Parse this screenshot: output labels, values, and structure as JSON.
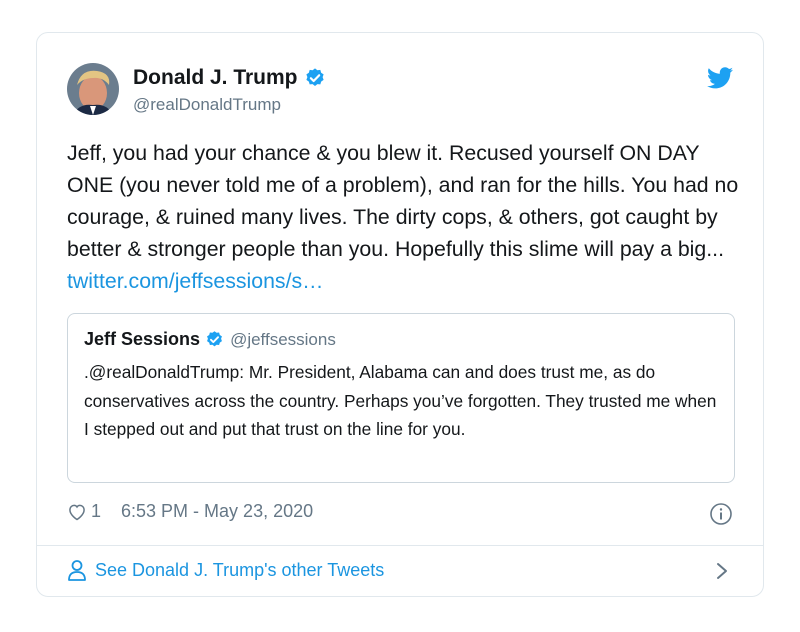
{
  "tweet": {
    "author": {
      "name": "Donald J. Trump",
      "handle": "@realDonaldTrump",
      "verified": true
    },
    "text_main": "Jeff, you had your chance & you blew it. Recused yourself ON DAY ONE (you never told me of a problem), and ran for the hills. You had no courage, & ruined many lives. The dirty cops, & others, got caught by better & stronger people than you. Hopefully this slime will pay a big... ",
    "link_text": "twitter.com/jeffsessions/s…",
    "quoted": {
      "author": {
        "name": "Jeff Sessions",
        "handle": "@jeffsessions",
        "verified": true
      },
      "text": ".@realDonaldTrump: Mr. President, Alabama can and does trust me, as do conservatives across the country. Perhaps you’ve forgotten. They trusted me when I stepped out and put that trust on the line for you."
    },
    "likes": "1",
    "timestamp": "6:53 PM - May 23, 2020"
  },
  "footer": {
    "see_more_label": "See Donald J. Trump's other Tweets"
  },
  "icons": {
    "brand": "twitter-bird-icon",
    "verified": "verified-badge-icon",
    "like": "heart-icon",
    "info": "info-icon",
    "profile": "person-icon",
    "chevron": "chevron-right-icon"
  },
  "colors": {
    "link": "#1b95e0",
    "muted": "#657786",
    "verified": "#1da1f2",
    "border": "#e1e8ed"
  }
}
